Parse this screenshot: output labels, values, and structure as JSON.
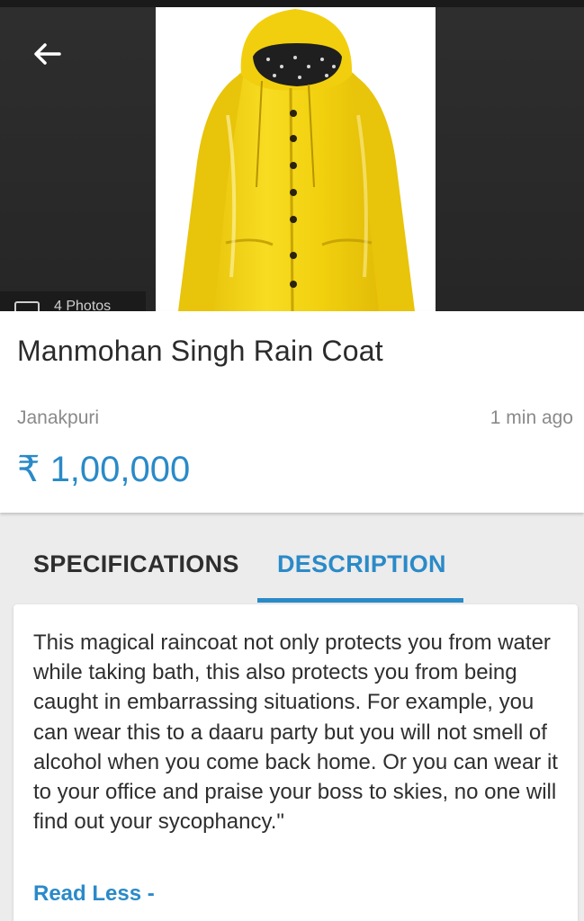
{
  "listing": {
    "title": "Manmohan Singh Rain Coat",
    "location": "Janakpuri",
    "posted": "1 min ago",
    "price": "₹ 1,00,000"
  },
  "gallery": {
    "photo_count_label": "4 Photos",
    "image_subject": "yellow hooded raincoat"
  },
  "tabs": [
    {
      "label": "SPECIFICATIONS",
      "active": false
    },
    {
      "label": "DESCRIPTION",
      "active": true
    }
  ],
  "description": {
    "text": "This magical raincoat not only protects you from water while taking bath, this also protects you from being caught in embarrassing situations. For example, you can wear this to a daaru party but you will not smell of alcohol when you come back home. Or you can wear it to your office and praise your boss to skies, no one will find out your sycophancy.\"",
    "toggle_label": "Read Less -"
  },
  "colors": {
    "accent": "#2a8ac8",
    "coat_yellow": "#f2d10f",
    "hero_bg": "#2b2b2b"
  },
  "icons": {
    "back": "arrow-left-icon",
    "camera": "camera-icon"
  }
}
